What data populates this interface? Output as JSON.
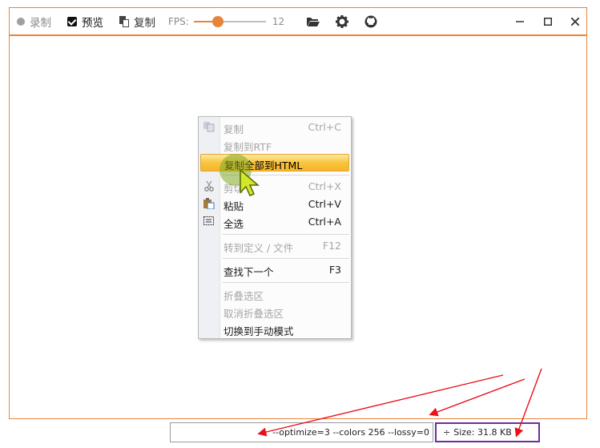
{
  "toolbar": {
    "record_label": "录制",
    "preview_label": "预览",
    "copy_label": "复制",
    "fps_label": "FPS:",
    "fps_value": "12",
    "fps_fraction": 0.3,
    "icons": [
      "folder-open-icon",
      "gear-icon",
      "github-icon"
    ]
  },
  "window_controls": [
    "minimize-icon",
    "maximize-icon",
    "close-icon"
  ],
  "context_menu": {
    "items": [
      {
        "label": "复制",
        "shortcut": "Ctrl+C",
        "state": "disabled",
        "icon": "copy-icon"
      },
      {
        "label": "复制到RTF",
        "shortcut": "",
        "state": "disabled",
        "icon": ""
      },
      {
        "label": "复制全部到HTML",
        "shortcut": "",
        "state": "highlighted",
        "icon": ""
      },
      {
        "label": "剪切",
        "shortcut": "Ctrl+X",
        "state": "disabled",
        "icon": "scissors-icon"
      },
      {
        "label": "粘贴",
        "shortcut": "Ctrl+V",
        "state": "enabled",
        "icon": "paste-icon"
      },
      {
        "label": "全选",
        "shortcut": "Ctrl+A",
        "state": "enabled",
        "icon": "select-all-icon"
      },
      {
        "label": "转到定义 /  文件",
        "shortcut": "F12",
        "state": "disabled",
        "icon": ""
      },
      {
        "label": "查找下一个",
        "shortcut": "F3",
        "state": "enabled",
        "icon": ""
      },
      {
        "label": "折叠选区",
        "shortcut": "",
        "state": "disabled",
        "icon": ""
      },
      {
        "label": "取消折叠选区",
        "shortcut": "",
        "state": "disabled",
        "icon": ""
      },
      {
        "label": "切换到手动模式",
        "shortcut": "",
        "state": "enabled",
        "icon": ""
      }
    ]
  },
  "status": {
    "params": "--optimize=3 --colors 256 --lossy=0",
    "size_label": "Size: 31.8 KB"
  },
  "colors": {
    "accent": "#e8833a",
    "annotation_arrow": "#e8111a",
    "size_box_border": "#6a2ea0",
    "highlight": "#f8c43e"
  }
}
